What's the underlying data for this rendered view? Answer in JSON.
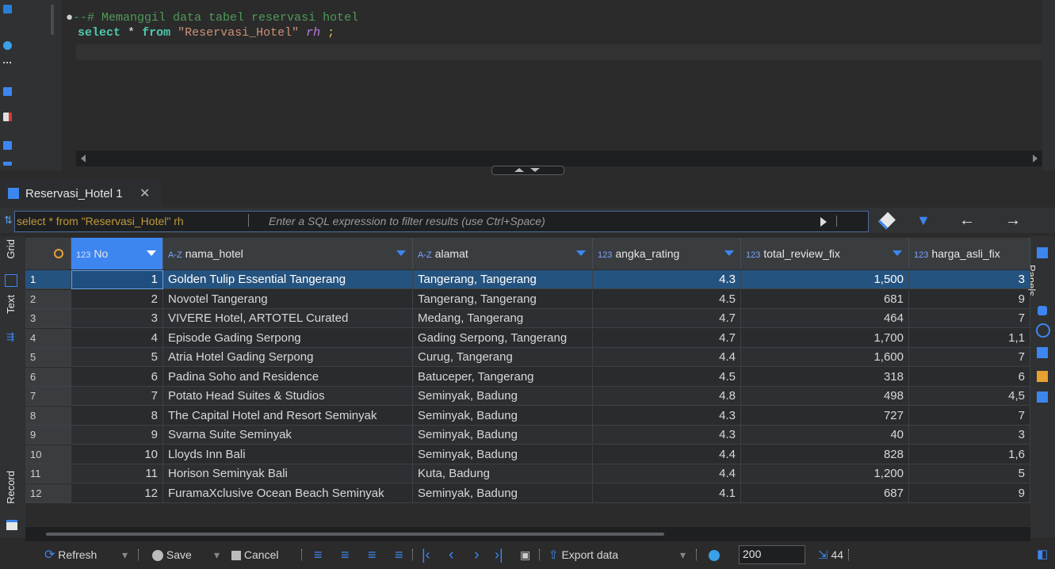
{
  "editor": {
    "comment_line": "--# Memanggil data tabel reservasi hotel",
    "query_keyword_select": "select",
    "query_star": "*",
    "query_keyword_from": "from",
    "query_table": "\"Reservasi_Hotel\"",
    "query_alias": "rh",
    "query_end": ";"
  },
  "result_tab": {
    "label": "Reservasi_Hotel 1"
  },
  "filter": {
    "query_echo": "select * from \"Reservasi_Hotel\" rh",
    "placeholder": "Enter a SQL expression to filter results (use Ctrl+Space)"
  },
  "side_tabs": {
    "grid": "Grid",
    "text": "Text",
    "record": "Record"
  },
  "right_panel": {
    "panels_label": "Panels"
  },
  "columns": [
    {
      "type": "123",
      "name": "No"
    },
    {
      "type": "A-Z",
      "name": "nama_hotel"
    },
    {
      "type": "A-Z",
      "name": "alamat"
    },
    {
      "type": "123",
      "name": "angka_rating"
    },
    {
      "type": "123",
      "name": "total_review_fix"
    },
    {
      "type": "123",
      "name": "harga_asli_fix"
    }
  ],
  "rows": [
    {
      "row": "1",
      "no": "1",
      "nama_hotel": "Golden Tulip Essential Tangerang",
      "alamat": "Tangerang, Tangerang",
      "rating": "4.3",
      "review": "1,500",
      "harga": "3"
    },
    {
      "row": "2",
      "no": "2",
      "nama_hotel": "Novotel Tangerang",
      "alamat": "Tangerang, Tangerang",
      "rating": "4.5",
      "review": "681",
      "harga": "9"
    },
    {
      "row": "3",
      "no": "3",
      "nama_hotel": "VIVERE Hotel, ARTOTEL Curated",
      "alamat": "Medang, Tangerang",
      "rating": "4.7",
      "review": "464",
      "harga": "7"
    },
    {
      "row": "4",
      "no": "4",
      "nama_hotel": "Episode Gading Serpong",
      "alamat": "Gading Serpong, Tangerang",
      "rating": "4.7",
      "review": "1,700",
      "harga": "1,1"
    },
    {
      "row": "5",
      "no": "5",
      "nama_hotel": "Atria Hotel Gading Serpong",
      "alamat": "Curug, Tangerang",
      "rating": "4.4",
      "review": "1,600",
      "harga": "7"
    },
    {
      "row": "6",
      "no": "6",
      "nama_hotel": "Padina Soho and Residence",
      "alamat": "Batuceper, Tangerang",
      "rating": "4.5",
      "review": "318",
      "harga": "6"
    },
    {
      "row": "7",
      "no": "7",
      "nama_hotel": "Potato Head Suites & Studios",
      "alamat": "Seminyak, Badung",
      "rating": "4.8",
      "review": "498",
      "harga": "4,5"
    },
    {
      "row": "8",
      "no": "8",
      "nama_hotel": "The Capital Hotel and Resort Seminyak",
      "alamat": "Seminyak, Badung",
      "rating": "4.3",
      "review": "727",
      "harga": "7"
    },
    {
      "row": "9",
      "no": "9",
      "nama_hotel": "Svarna Suite Seminyak",
      "alamat": "Seminyak, Badung",
      "rating": "4.3",
      "review": "40",
      "harga": "3"
    },
    {
      "row": "10",
      "no": "10",
      "nama_hotel": "Lloyds Inn Bali",
      "alamat": "Seminyak, Badung",
      "rating": "4.4",
      "review": "828",
      "harga": "1,6"
    },
    {
      "row": "11",
      "no": "11",
      "nama_hotel": "Horison Seminyak Bali",
      "alamat": "Kuta, Badung",
      "rating": "4.4",
      "review": "1,200",
      "harga": "5"
    },
    {
      "row": "12",
      "no": "12",
      "nama_hotel": "FuramaXclusive Ocean Beach Seminyak",
      "alamat": "Seminyak, Badung",
      "rating": "4.1",
      "review": "687",
      "harga": "9"
    }
  ],
  "bottom_toolbar": {
    "refresh": "Refresh",
    "save": "Save",
    "cancel": "Cancel",
    "export": "Export data",
    "fetch_size": "200",
    "row_count": "44"
  },
  "colors": {
    "accent": "#3d86f0",
    "keyword": "#4ec9b0",
    "comment": "#4e9a58",
    "string": "#ce9178",
    "selection": "#25537f"
  }
}
